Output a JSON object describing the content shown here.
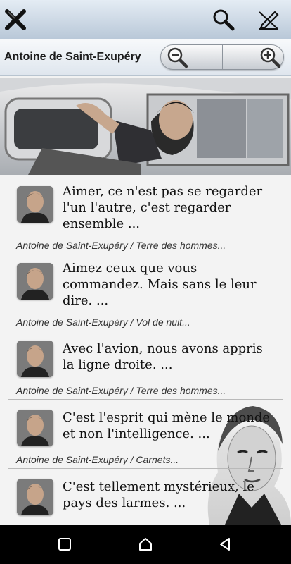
{
  "toolbar": {
    "close_icon": "close-x-icon",
    "search_icon": "search-icon",
    "edit_icon": "edit-pen-icon"
  },
  "subbar": {
    "title": "Antoine de Saint-Exupéry",
    "zoom_out_icon": "zoom-out-icon",
    "zoom_in_icon": "zoom-in-icon"
  },
  "quotes": [
    {
      "text": "Aimer, ce n'est pas se regarder l'un l'autre, c'est regarder ensemble  ...",
      "source": "Antoine de Saint-Exupéry / Terre des hommes..."
    },
    {
      "text": "Aimez ceux que vous commandez. Mais sans le leur dire. ...",
      "source": "Antoine de Saint-Exupéry / Vol de nuit..."
    },
    {
      "text": "Avec l'avion, nous avons appris la ligne droite. ...",
      "source": "Antoine de Saint-Exupéry / Terre des hommes..."
    },
    {
      "text": "C'est l'esprit qui mène le monde et non l'intelligence. ...",
      "source": "Antoine de Saint-Exupéry / Carnets..."
    },
    {
      "text": "C'est tellement mystérieux, le pays des larmes. ...",
      "source": ""
    }
  ],
  "navbar": {
    "recents_icon": "recents-square-icon",
    "home_icon": "home-icon",
    "back_icon": "back-triangle-icon"
  },
  "colors": {
    "toolbar_top": "#e4ecf4",
    "toolbar_bottom": "#b9c8d8",
    "list_bg": "#f3f3f3",
    "navbar": "#000000"
  }
}
